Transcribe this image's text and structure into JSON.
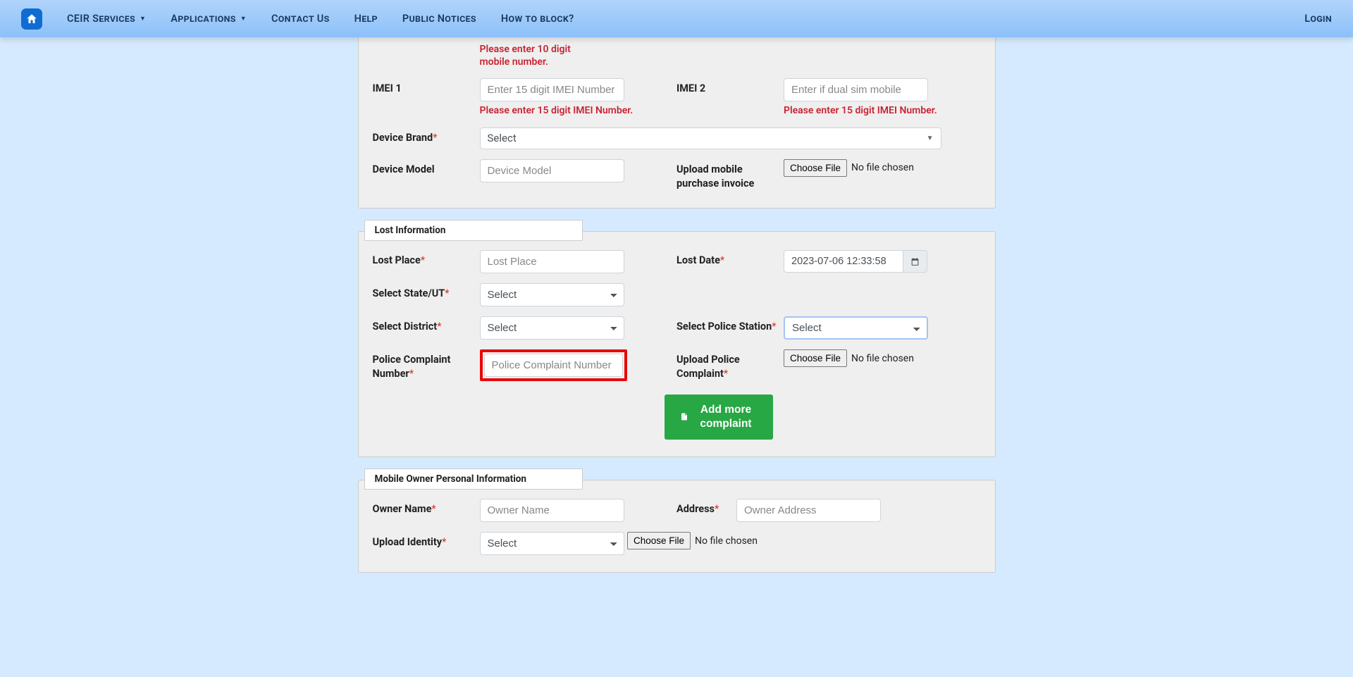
{
  "nav": {
    "ceir_services": "CEIR Services",
    "applications": "Applications",
    "contact_us": "Contact Us",
    "help": "Help",
    "public_notices": "Public Notices",
    "how_to_block": "How to block?",
    "login": "Login"
  },
  "device": {
    "mobile_err": "Please enter 10 digit mobile number.",
    "imei1_label": "IMEI 1",
    "imei1_ph": "Enter 15 digit IMEI Number",
    "imei1_err": "Please enter 15 digit IMEI Number.",
    "imei2_label": "IMEI 2",
    "imei2_ph": "Enter if dual sim mobile",
    "imei2_err": "Please enter 15 digit IMEI Number.",
    "brand_label": "Device Brand",
    "brand_select": "Select",
    "model_label": "Device Model",
    "model_ph": "Device Model",
    "invoice_label": "Upload mobile purchase invoice",
    "choose_file": "Choose File",
    "no_file": "No file chosen"
  },
  "lost": {
    "legend": "Lost Information",
    "place_label": "Lost Place",
    "place_ph": "Lost Place",
    "date_label": "Lost Date",
    "date_value": "2023-07-06 12:33:58",
    "state_label": "Select State/UT",
    "district_label": "Select District",
    "police_station_label": "Select Police Station",
    "select_opt": "Select",
    "complaint_num_label": "Police Complaint Number",
    "complaint_num_ph": "Police Complaint Number",
    "upload_complaint_label": "Upload Police Complaint",
    "choose_file": "Choose File",
    "no_file": "No file chosen",
    "add_more": "Add more complaint"
  },
  "owner": {
    "legend": "Mobile Owner Personal Information",
    "name_label": "Owner Name",
    "name_ph": "Owner Name",
    "address_label": "Address",
    "address_ph": "Owner Address",
    "identity_label": "Upload Identity",
    "select_opt": "Select",
    "choose_file": "Choose File",
    "no_file": "No file chosen"
  }
}
